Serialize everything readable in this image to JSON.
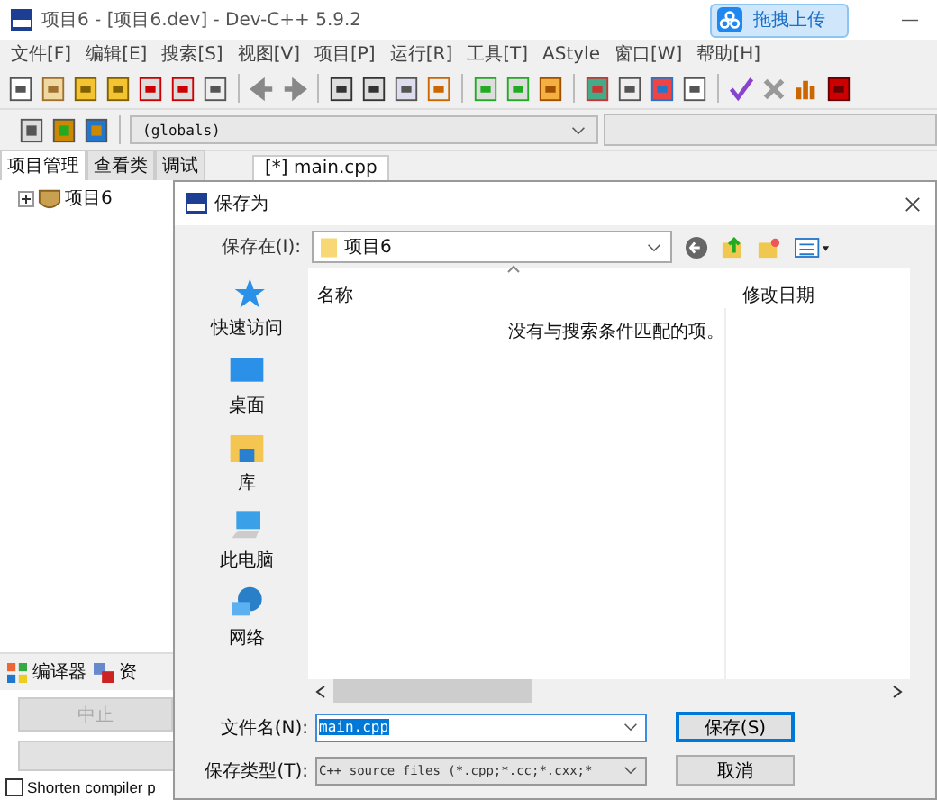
{
  "window": {
    "title": "项目6 - [项目6.dev] - Dev-C++ 5.9.2",
    "minimize": "—"
  },
  "upload_button": "拖拽上传",
  "menu": [
    "文件[F]",
    "编辑[E]",
    "搜索[S]",
    "视图[V]",
    "项目[P]",
    "运行[R]",
    "工具[T]",
    "AStyle",
    "窗口[W]",
    "帮助[H]"
  ],
  "scope_field": {
    "value": "(globals)"
  },
  "side_tabs": [
    {
      "label": "项目管理",
      "selected": true
    },
    {
      "label": "查看类",
      "selected": false
    },
    {
      "label": "调试",
      "selected": false
    }
  ],
  "editor_tabs": [
    {
      "label": "[*] main.cpp",
      "selected": true
    }
  ],
  "tree": [
    {
      "label": "项目6",
      "expanded": false
    }
  ],
  "bottom_tabs": [
    {
      "label": "编译器"
    },
    {
      "label": "资"
    }
  ],
  "abort_button": {
    "label": "中止",
    "disabled": true
  },
  "shorten_checkbox": {
    "label": "Shorten compiler p",
    "checked": false
  },
  "dialog": {
    "title": "保存为",
    "save_in_label": "保存在(I):",
    "save_in_value": "项目6",
    "places": [
      {
        "label": "快速访问",
        "kind": "star"
      },
      {
        "label": "桌面",
        "kind": "desktop"
      },
      {
        "label": "库",
        "kind": "library"
      },
      {
        "label": "此电脑",
        "kind": "computer"
      },
      {
        "label": "网络",
        "kind": "network"
      }
    ],
    "columns": [
      "名称",
      "修改日期"
    ],
    "empty_message": "没有与搜索条件匹配的项。",
    "filename_label": "文件名(N):",
    "filename_value": "main.cpp",
    "filename_selected": true,
    "filetype_label": "保存类型(T):",
    "filetype_value": "C++ source files (*.cpp;*.cc;*.cxx;*",
    "buttons": [
      "保存(S)",
      "取消"
    ]
  }
}
